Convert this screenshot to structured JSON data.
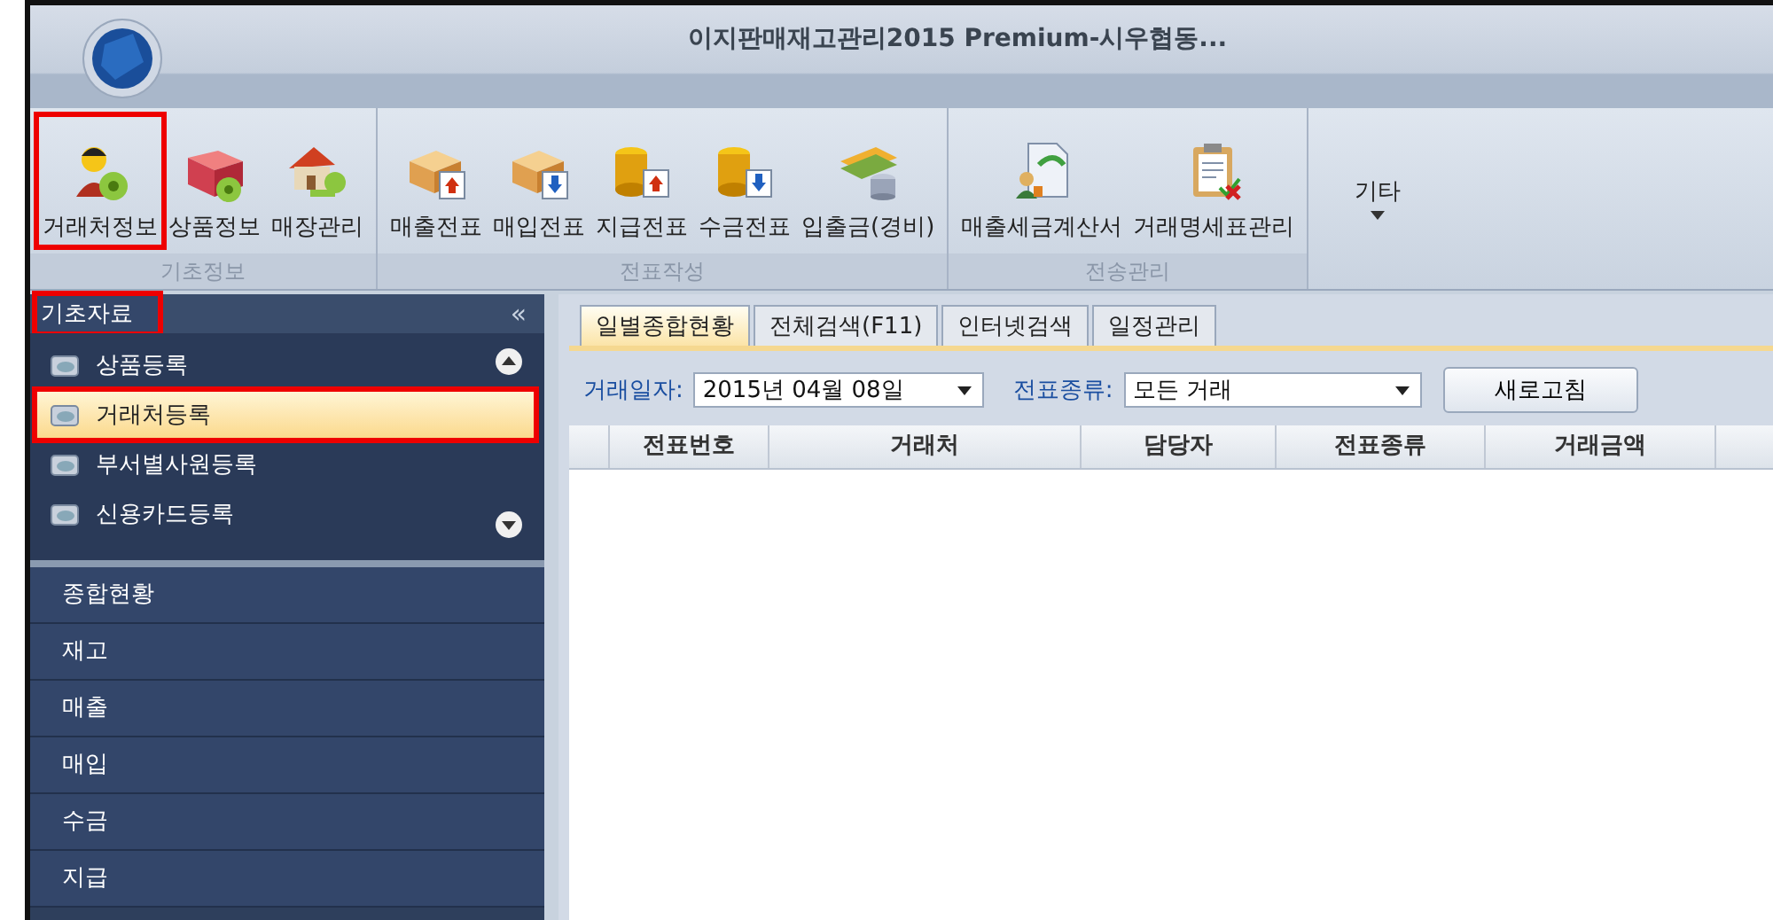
{
  "window": {
    "title": "이지판매재고관리2015 Premium-시우협동..."
  },
  "ribbon": {
    "groups": [
      {
        "label": "기초정보",
        "buttons": [
          {
            "label": "거래처정보",
            "highlighted": true
          },
          {
            "label": "상품정보",
            "highlighted": false
          },
          {
            "label": "매장관리",
            "highlighted": false
          }
        ]
      },
      {
        "label": "전표작성",
        "buttons": [
          {
            "label": "매출전표",
            "highlighted": false
          },
          {
            "label": "매입전표",
            "highlighted": false
          },
          {
            "label": "지급전표",
            "highlighted": false
          },
          {
            "label": "수금전표",
            "highlighted": false
          },
          {
            "label": "입출금(경비)",
            "highlighted": false
          }
        ]
      },
      {
        "label": "전송관리",
        "buttons": [
          {
            "label": "매출세금계산서",
            "highlighted": false
          },
          {
            "label": "거래명세표관리",
            "highlighted": false
          }
        ]
      }
    ],
    "more": {
      "label": "기타"
    }
  },
  "sidebar": {
    "header": {
      "label": "기초자료",
      "highlighted": true
    },
    "collapse": "«",
    "items": [
      {
        "label": "상품등록",
        "selected": false,
        "highlighted": false
      },
      {
        "label": "거래처등록",
        "selected": true,
        "highlighted": true
      },
      {
        "label": "부서별사원등록",
        "selected": false,
        "highlighted": false
      },
      {
        "label": "신용카드등록",
        "selected": false,
        "highlighted": false
      }
    ],
    "nav": [
      "종합현황",
      "재고",
      "매출",
      "매입",
      "수금",
      "지급"
    ]
  },
  "tabs": [
    {
      "label": "일별종합현황",
      "selected": true
    },
    {
      "label": "전체검색(F11)",
      "selected": false
    },
    {
      "label": "인터넷검색",
      "selected": false
    },
    {
      "label": "일정관리",
      "selected": false
    }
  ],
  "filters": {
    "date_label": "거래일자:",
    "date_value": "2015년 04월 08일",
    "type_label": "전표종류:",
    "type_value": "모든 거래",
    "refresh": "새로고침"
  },
  "table": {
    "columns": [
      "전표번호",
      "거래처",
      "담당자",
      "전표종류",
      "거래금액"
    ]
  }
}
